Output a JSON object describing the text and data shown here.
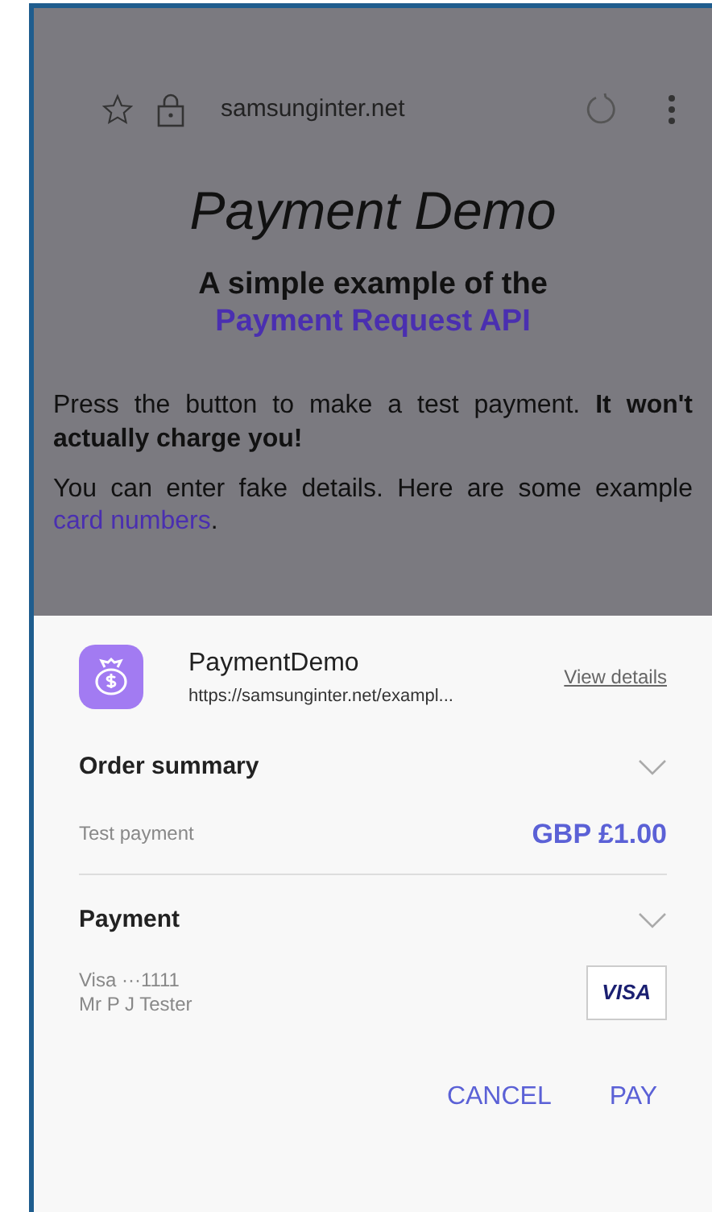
{
  "browser_bar": {
    "url": "samsunginter.net"
  },
  "page": {
    "title": "Payment Demo",
    "heading": "A simple example of the",
    "heading_link": "Payment Request API",
    "paragraphs": [
      {
        "text": "Press the button to make a test payment. **It won't actually charge you!**"
      },
      {
        "text": "You can enter fake details. Here are some example",
        "link": "card numbers",
        "after": "."
      }
    ]
  },
  "payment_sheet": {
    "app_name": "PaymentDemo",
    "origin": "https://samsunginter.net/exampl...",
    "details_link": "View details",
    "sections": [
      {
        "kind": "order",
        "title": "Order summary",
        "expanded": false,
        "label": "Test payment",
        "amount": "GBP £1.00"
      },
      {
        "kind": "card",
        "title": "Payment",
        "expanded": false,
        "lines": [
          "Visa ···1111",
          "Mr P J Tester"
        ],
        "card_logo": "VISA"
      }
    ],
    "buttons": [
      "CANCEL",
      "PAY"
    ]
  }
}
